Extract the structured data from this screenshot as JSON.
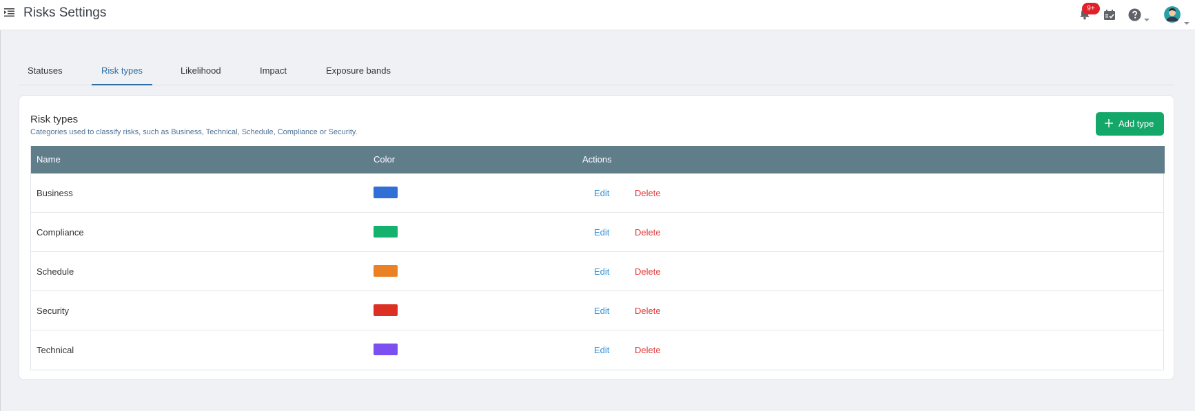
{
  "header": {
    "title": "Risks Settings",
    "notification_badge": "9+",
    "icons": [
      "menu-collapse-icon",
      "bell-icon",
      "calendar-check-icon",
      "help-icon",
      "avatar"
    ]
  },
  "tabs": [
    {
      "label": "Statuses",
      "active": false
    },
    {
      "label": "Risk types",
      "active": true
    },
    {
      "label": "Likelihood",
      "active": false
    },
    {
      "label": "Impact",
      "active": false
    },
    {
      "label": "Exposure bands",
      "active": false
    }
  ],
  "card": {
    "title": "Risk types",
    "description": "Categories used to classify risks, such as Business, Technical, Schedule, Compliance or Security.",
    "add_button": "Add type"
  },
  "table": {
    "columns": [
      "Name",
      "Color",
      "Actions"
    ],
    "edit_label": "Edit",
    "delete_label": "Delete",
    "rows": [
      {
        "name": "Business",
        "color": "#2f6fd6"
      },
      {
        "name": "Compliance",
        "color": "#15b26d"
      },
      {
        "name": "Schedule",
        "color": "#ea8225"
      },
      {
        "name": "Security",
        "color": "#dd3024"
      },
      {
        "name": "Technical",
        "color": "#7b4ff0"
      }
    ]
  },
  "colors": {
    "accent": "#2e6da4",
    "primary_button": "#13a86a",
    "table_header": "#607d8a",
    "badge": "#e0202a",
    "edit_link": "#2b8fd8",
    "delete_link": "#e23b3b"
  }
}
